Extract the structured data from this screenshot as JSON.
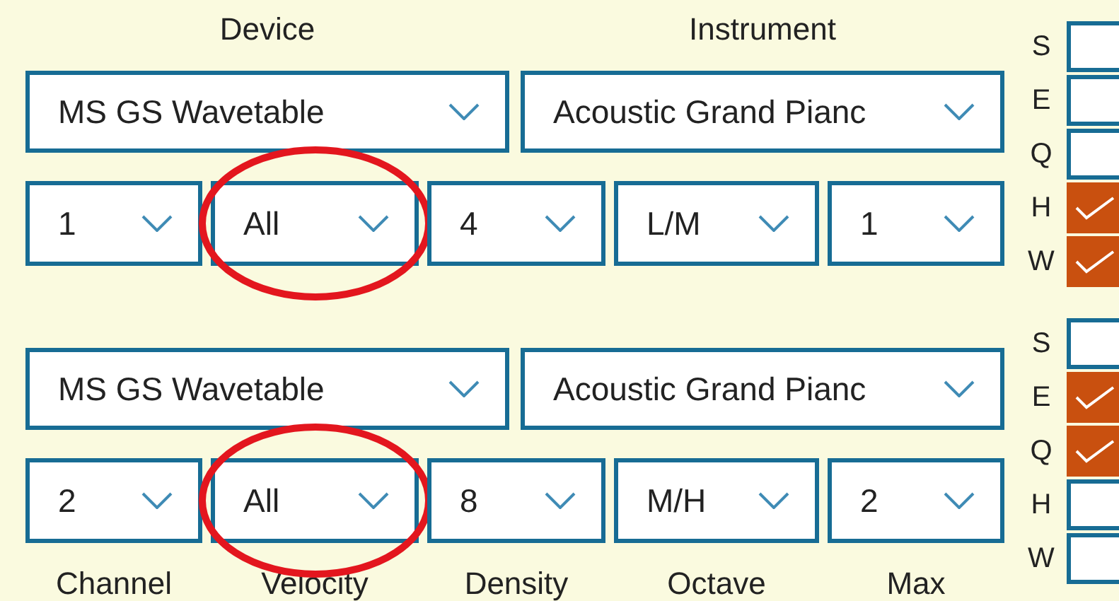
{
  "headers": [
    "Device",
    "Instrument"
  ],
  "groups": [
    {
      "device": "MS GS Wavetable",
      "instrument": "Acoustic Grand Pianc",
      "selectors": [
        {
          "value": "1",
          "circled": false
        },
        {
          "value": "All",
          "circled": true
        },
        {
          "value": "4",
          "circled": false
        },
        {
          "value": "L/M",
          "circled": false
        },
        {
          "value": "1",
          "circled": false
        }
      ],
      "flags": [
        {
          "label": "S",
          "checked": false
        },
        {
          "label": "E",
          "checked": false
        },
        {
          "label": "Q",
          "checked": false
        },
        {
          "label": "H",
          "checked": true
        },
        {
          "label": "W",
          "checked": true
        }
      ]
    },
    {
      "device": "MS GS Wavetable",
      "instrument": "Acoustic Grand Pianc",
      "selectors": [
        {
          "value": "2",
          "circled": false
        },
        {
          "value": "All",
          "circled": true
        },
        {
          "value": "8",
          "circled": false
        },
        {
          "value": "M/H",
          "circled": false
        },
        {
          "value": "2",
          "circled": false
        }
      ],
      "flags": [
        {
          "label": "S",
          "checked": false
        },
        {
          "label": "E",
          "checked": true
        },
        {
          "label": "Q",
          "checked": true
        },
        {
          "label": "H",
          "checked": false
        },
        {
          "label": "W",
          "checked": false
        }
      ]
    }
  ],
  "footer_labels": [
    "Channel",
    "Velocity",
    "Density",
    "Octave",
    "Max"
  ]
}
